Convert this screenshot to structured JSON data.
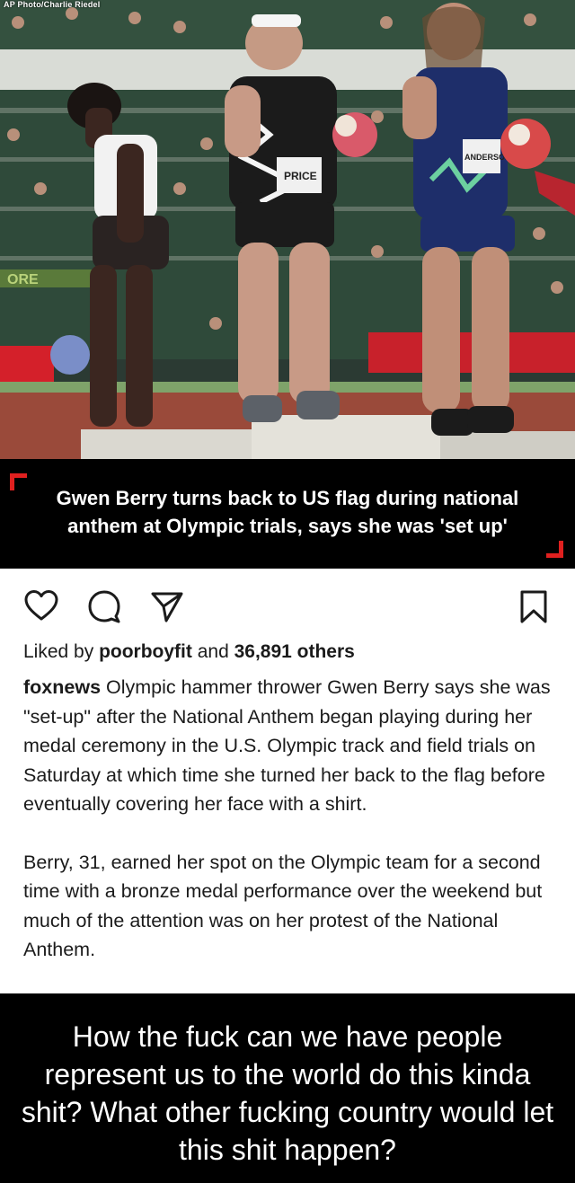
{
  "photo": {
    "credit": "AP Photo/Charlie Riedel",
    "bib_left": "PRICE",
    "bib_right": "ANDERSON",
    "banner_fragment": "ORE"
  },
  "headline": "Gwen Berry turns back to US flag during national anthem at Olympic trials, says she was 'set up'",
  "accent_color": "#e0201f",
  "actions": {
    "like_icon": "heart-icon",
    "comment_icon": "comment-icon",
    "share_icon": "send-icon",
    "save_icon": "bookmark-icon"
  },
  "likes": {
    "prefix": "Liked by ",
    "user": "poorboyfit",
    "middle": " and ",
    "count": "36,891 others"
  },
  "caption": {
    "username": "foxnews",
    "paragraph1": " Olympic hammer thrower Gwen Berry says she was \"set-up\" after the National Anthem began playing during her medal ceremony in the U.S. Olympic track and field trials on Saturday at which time she turned her back to the flag before eventually covering her face with a shirt.",
    "paragraph2": "Berry, 31, earned her spot on the Olympic team for a second time with a bronze medal performance over the weekend but much of the attention was on her protest of the National Anthem."
  },
  "meme_text": "How the fuck can we have people represent us to the world do this kinda shit? What other fucking country would let this shit happen?"
}
